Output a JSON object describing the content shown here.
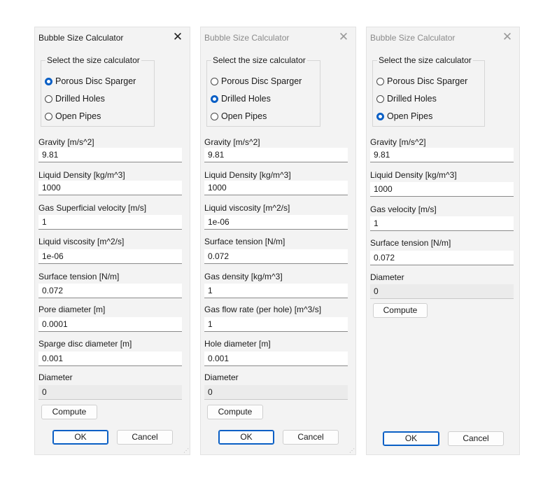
{
  "dialogs": [
    {
      "title": "Bubble Size Calculator",
      "group_title": "Select the size calculator",
      "options": [
        "Porous Disc Sparger",
        "Drilled Holes",
        "Open Pipes"
      ],
      "selected_option": 0,
      "fields": [
        {
          "label": "Gravity [m/s^2]",
          "value": "9.81"
        },
        {
          "label": "Liquid Density  [kg/m^3]",
          "value": "1000"
        },
        {
          "label": "Gas Superficial velocity [m/s]",
          "value": "1"
        },
        {
          "label": "Liquid viscosity [m^2/s]",
          "value": "1e-06"
        },
        {
          "label": "Surface tension [N/m]",
          "value": "0.072"
        },
        {
          "label": "Pore diameter [m]",
          "value": "0.0001"
        },
        {
          "label": "Sparge disc diameter [m]",
          "value": "0.001"
        }
      ],
      "result": {
        "label": "Diameter",
        "value": "0"
      },
      "compute_label": "Compute",
      "ok_label": "OK",
      "cancel_label": "Cancel"
    },
    {
      "title": "Bubble Size Calculator",
      "group_title": "Select the size calculator",
      "options": [
        "Porous Disc Sparger",
        "Drilled Holes",
        "Open Pipes"
      ],
      "selected_option": 1,
      "fields": [
        {
          "label": "Gravity [m/s^2]",
          "value": "9.81"
        },
        {
          "label": "Liquid Density  [kg/m^3]",
          "value": "1000"
        },
        {
          "label": "Liquid viscosity [m^2/s]",
          "value": "1e-06"
        },
        {
          "label": "Surface tension [N/m]",
          "value": "0.072"
        },
        {
          "label": "Gas density [kg/m^3]",
          "value": "1"
        },
        {
          "label": "Gas flow rate (per hole) [m^3/s]",
          "value": "1"
        },
        {
          "label": "Hole diameter [m]",
          "value": "0.001"
        }
      ],
      "result": {
        "label": "Diameter",
        "value": "0"
      },
      "compute_label": "Compute",
      "ok_label": "OK",
      "cancel_label": "Cancel"
    },
    {
      "title": "Bubble Size Calculator",
      "group_title": "Select the size calculator",
      "options": [
        "Porous Disc Sparger",
        "Drilled Holes",
        "Open Pipes"
      ],
      "selected_option": 2,
      "fields": [
        {
          "label": "Gravity [m/s^2]",
          "value": "9.81"
        },
        {
          "label": "Liquid Density  [kg/m^3]",
          "value": "1000"
        },
        {
          "label": "Gas velocity [m/s]",
          "value": "1"
        },
        {
          "label": "Surface tension [N/m]",
          "value": "0.072"
        }
      ],
      "result": {
        "label": "Diameter",
        "value": "0"
      },
      "compute_label": "Compute",
      "ok_label": "OK",
      "cancel_label": "Cancel"
    }
  ]
}
